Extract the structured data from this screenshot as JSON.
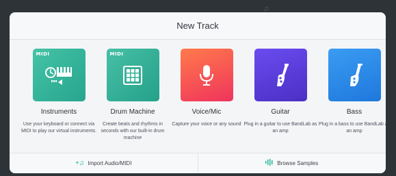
{
  "background": {
    "note_icon": "music-note-icon"
  },
  "modal": {
    "title": "New Track"
  },
  "cards": [
    {
      "id": "instruments",
      "badge": "MIDI",
      "title": "Instruments",
      "description": "Use your keyboard or connect via MIDI to play our virtual instruments.",
      "icon": "piano-trumpet-icon",
      "color": "#2eb397"
    },
    {
      "id": "drum",
      "badge": "MIDI",
      "title": "Drum Machine",
      "description": "Create beats and rhythms in seconds with our built-in drum machine",
      "icon": "drum-pads-icon",
      "color": "#2eb397"
    },
    {
      "id": "voice",
      "title": "Voice/Mic",
      "description": "Capture your voice or any sound",
      "icon": "microphone-icon",
      "color": "#f64b55"
    },
    {
      "id": "guitar",
      "title": "Guitar",
      "description": "Plug in a guitar to use BandLab as an amp",
      "icon": "guitar-icon",
      "color": "#5a3ddc"
    },
    {
      "id": "bass",
      "title": "Bass",
      "description": "Plug in a bass to use BandLab as an amp",
      "icon": "bass-icon",
      "color": "#2a8ae8"
    }
  ],
  "footer": {
    "import_label": "Import Audio/MIDI",
    "import_icon": "music-plus-icon",
    "browse_label": "Browse Samples",
    "browse_icon": "waveform-icon",
    "accent": "#21b597"
  }
}
